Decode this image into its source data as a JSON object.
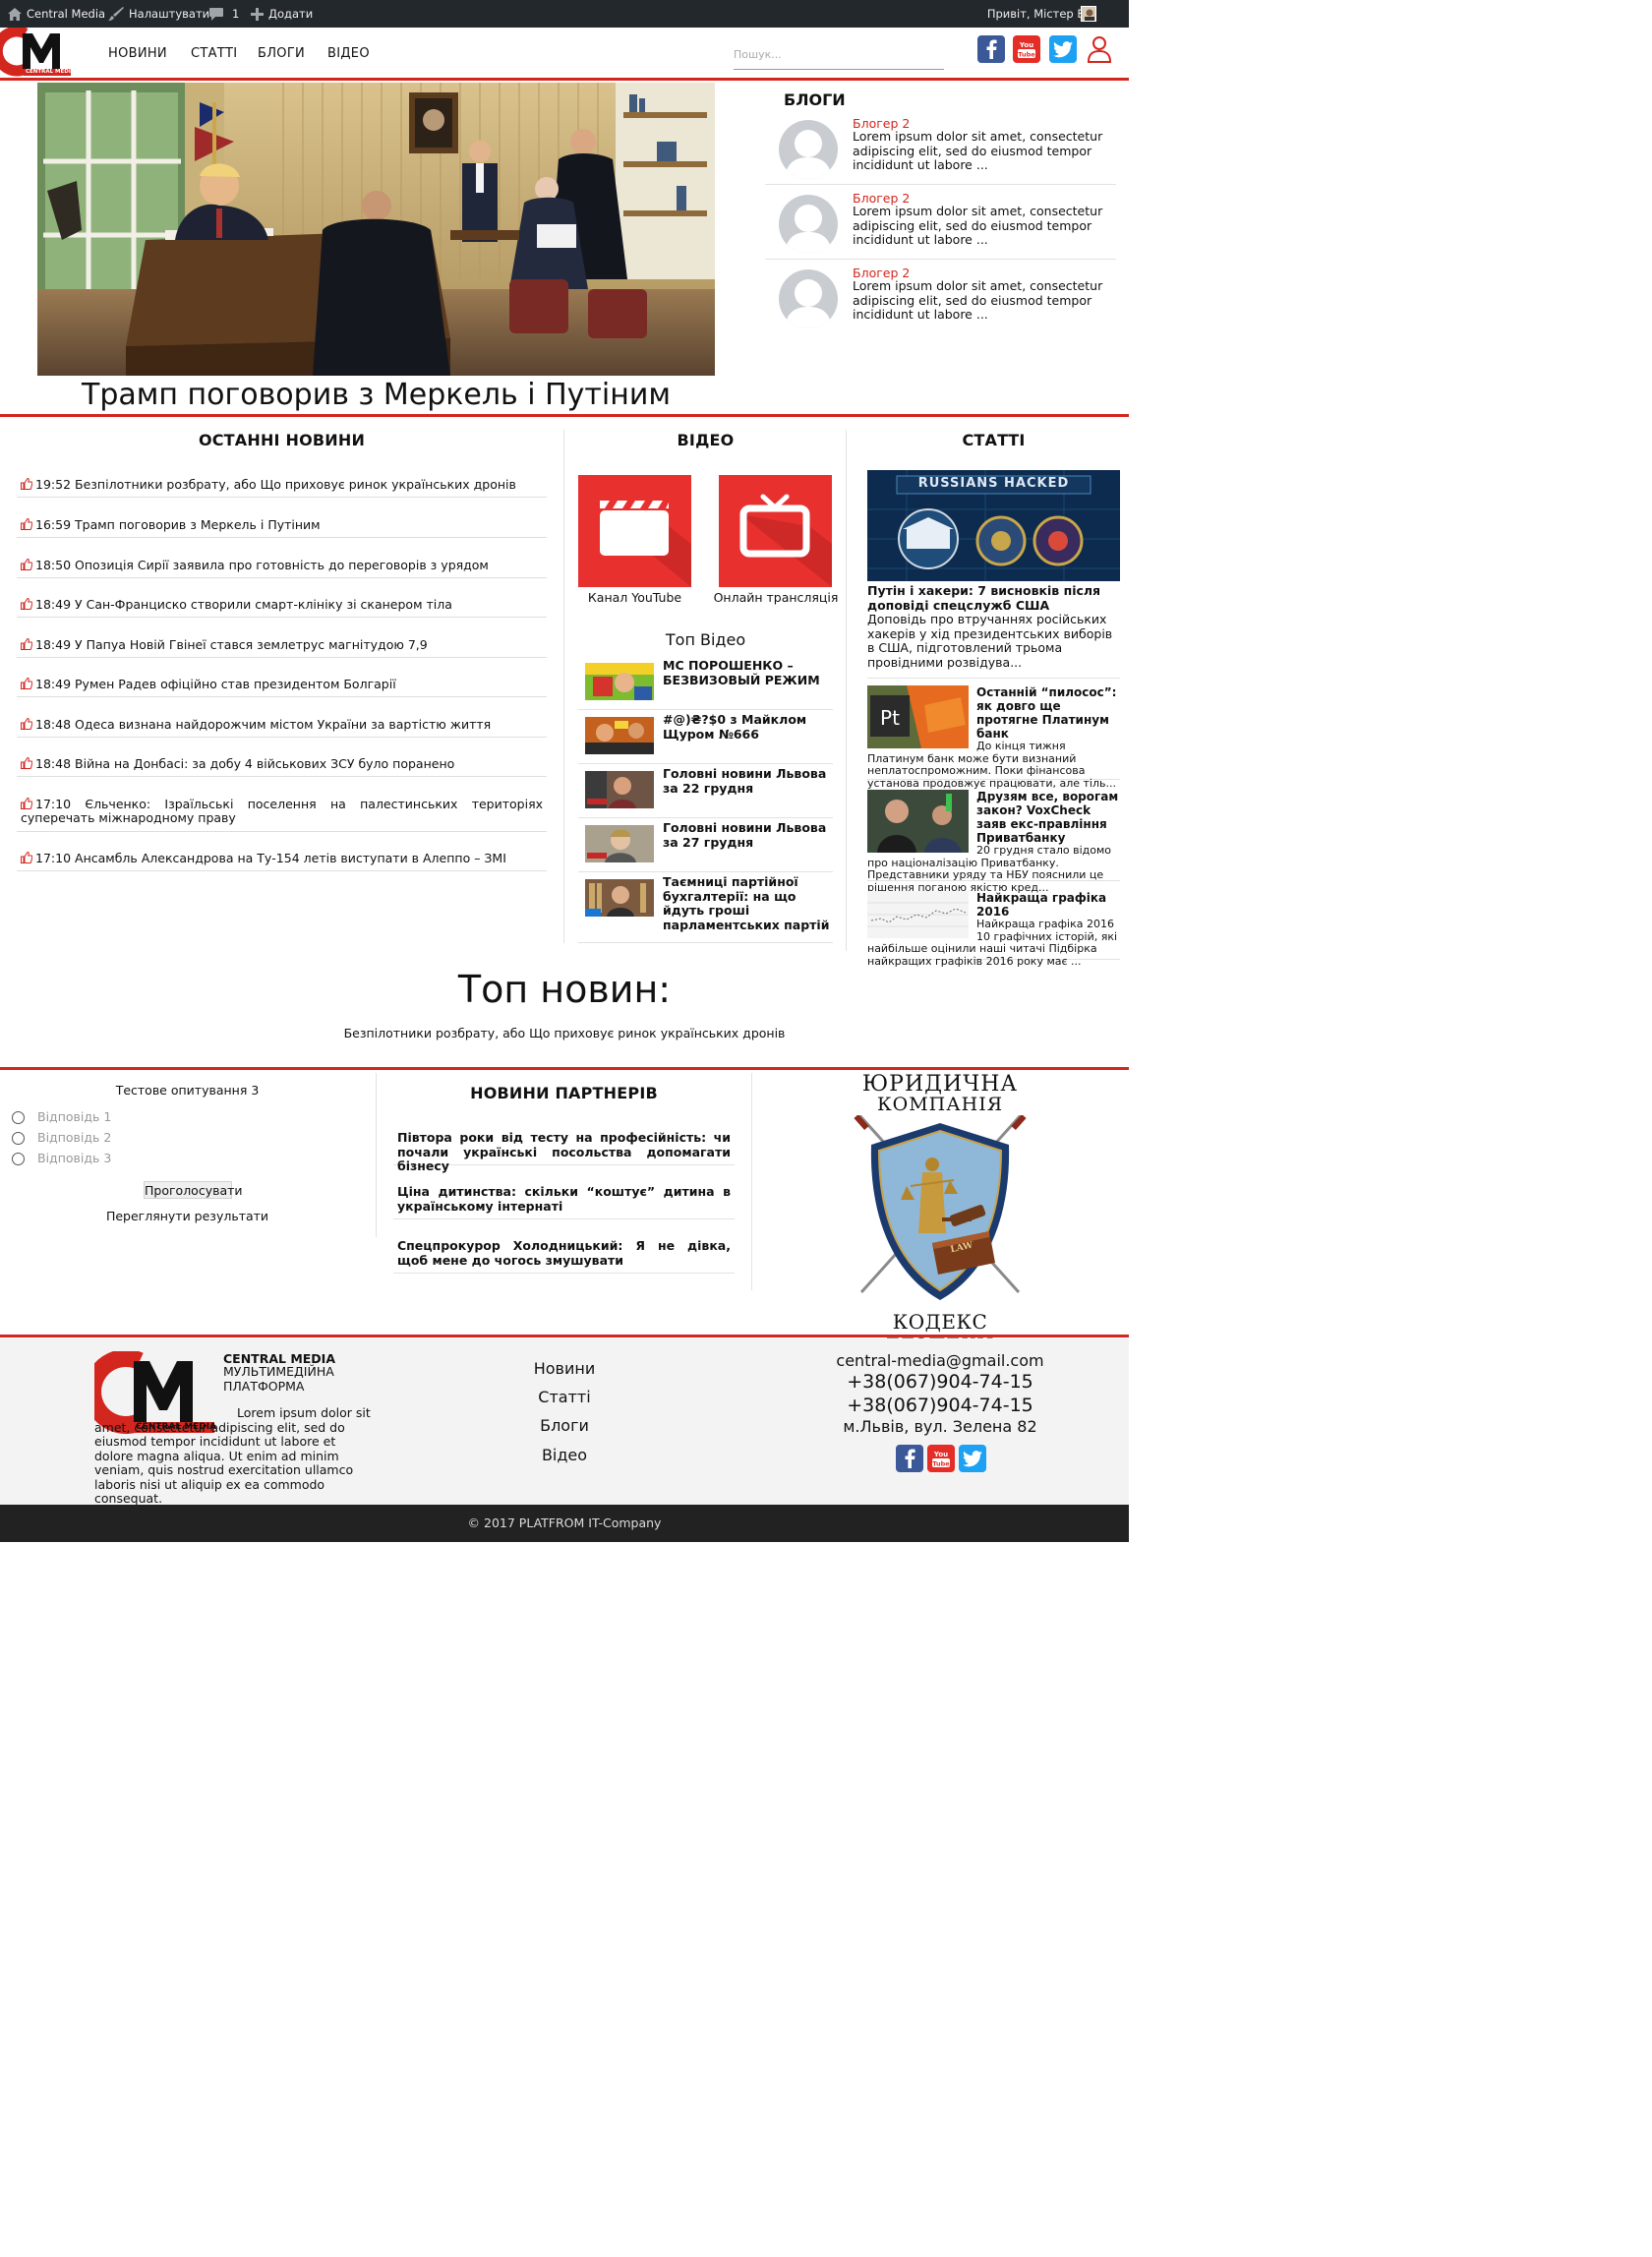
{
  "admin_bar": {
    "site_name": "Central Media",
    "customize": "Налаштувати",
    "comments_count": "1",
    "add_new": "Додати",
    "greeting": "Привіт, Містер Бін"
  },
  "header": {
    "logo_letters": "CM",
    "logo_caption": "CENTRAL MEDIA",
    "nav": [
      "НОВИНИ",
      "СТАТТІ",
      "БЛОГИ",
      "ВІДЕО"
    ],
    "search_placeholder": "Пошук..."
  },
  "hero": {
    "title": "Трамп поговорив з Меркель і Путіним"
  },
  "blogs": {
    "title": "БЛОГИ",
    "items": [
      {
        "author": "Блогер 2",
        "text": "Lorem ipsum dolor sit amet, consectetur adipiscing elit, sed do eiusmod tempor incididunt ut labore ..."
      },
      {
        "author": "Блогер 2",
        "text": "Lorem ipsum dolor sit amet, consectetur adipiscing elit, sed do eiusmod tempor incididunt ut labore ..."
      },
      {
        "author": "Блогер 2",
        "text": "Lorem ipsum dolor sit amet, consectetur adipiscing elit, sed do eiusmod tempor incididunt ut labore ..."
      }
    ]
  },
  "latest_news": {
    "title": "ОСТАННІ НОВИНИ",
    "items": [
      {
        "time": "19:52",
        "title": "Безпілотники розбрату, або Що приховує ринок українських дронів"
      },
      {
        "time": "16:59",
        "title": "Трамп поговорив з Меркель і Путіним"
      },
      {
        "time": "18:50",
        "title": "Опозиція Сирії заявила про готовність до переговорів з урядом"
      },
      {
        "time": "18:49",
        "title": "У Сан-Франциско створили смарт-клініку зі сканером тіла"
      },
      {
        "time": "18:49",
        "title": "У Папуа Новій Гвінеї стався землетрус магнітудою 7,9"
      },
      {
        "time": "18:49",
        "title": "Румен Радев офіційно став президентом Болгарії"
      },
      {
        "time": "18:48",
        "title": "Одеса визнана найдорожчим містом України за вартістю життя"
      },
      {
        "time": "18:48",
        "title": "Війна на Донбасі: за добу 4 військових ЗСУ було поранено"
      },
      {
        "time": "17:10",
        "title": "Єльченко: Ізраїльські поселення на палестинських територіях суперечать міжнародному праву"
      },
      {
        "time": "17:10",
        "title": "Ансамбль Александрова на Ту-154 летів виступати в Алеппо – ЗМІ"
      }
    ]
  },
  "video": {
    "title": "ВІДЕО",
    "youtube_label": "Канал YouTube",
    "live_label": "Онлайн трансляція",
    "top_title": "Топ Відео",
    "top_items": [
      "МС ПОРОШЕНКО – БЕЗВИЗОВЫЙ РЕЖИМ",
      "#@)₴?$0 з Майклом Щуром №666",
      "Головні новини Львова за 22 грудня",
      "Головні новини Львова за 27 грудня",
      "Таємниці партійної бухгалтерії: на що йдуть гроші парламентських партій"
    ]
  },
  "articles": {
    "title": "СТАТТІ",
    "featured": {
      "image_banner": "RUSSIANS HACKED",
      "title": "Путін і хакери: 7 висновків після доповіді спецслужб США",
      "excerpt": "Доповідь про втручаннях російських хакерів у хід президентських виборів в США, підготовлений трьома провідними розвідува..."
    },
    "items": [
      {
        "title": "Останній “пилосос”: як довго ще протягне Платинум банк",
        "excerpt": "До кінця тижня Платинум банк може бути визнаний неплатоспроможним. Поки фінансова установа продовжує працювати, але тіль...",
        "thumb_text": "Pt"
      },
      {
        "title": "Друзям все, ворогам закон? VoxCheck заяв екс-правління Приватбанку",
        "excerpt": "20 грудня стало відомо про націоналізацію Приватбанку. Представники уряду та НБУ пояснили це рішення поганою якістю кред..."
      },
      {
        "title": "Найкраща графіка 2016",
        "excerpt": "Найкраща графіка 2016 10 графічних історій, які найбільше оцінили наші читачі Підбірка найкращих графіків 2016 року має ..."
      }
    ]
  },
  "top_news": {
    "title": "Топ новин:",
    "link": "Безпілотники розбрату, або Що приховує ринок українських дронів"
  },
  "poll": {
    "question": "Тестове опитування 3",
    "answers": [
      "Відповідь 1",
      "Відповідь 2",
      "Відповідь 3"
    ],
    "vote_button": "Проголосувати",
    "results_link": "Переглянути результати"
  },
  "partners": {
    "title": "НОВИНИ ПАРТНЕРІВ",
    "items": [
      "Півтора роки від тесту на професійність: чи почали українські посольства допомагати бізнесу",
      "Ціна дитинства: скільки “коштує” дитина в українському інтернаті",
      "Спецпрокурор Холодницький: Я не дівка, щоб мене до чогось змушувати"
    ]
  },
  "ad": {
    "line1": "ЮРИДИЧНА",
    "line2": "КОМПАНІЯ",
    "shield_text": "LAW",
    "bottom": "КОДЕКС БЕЗПЕКИ"
  },
  "footer": {
    "brand": "CENTRAL MEDIA",
    "tagline": "МУЛЬТИМЕДІЙНА ПЛАТФОРМА",
    "description": "Lorem ipsum dolor sit amet, consectetur adipiscing elit, sed do eiusmod tempor incididunt ut labore et dolore magna aliqua. Ut enim ad minim veniam, quis nostrud exercitation ullamco laboris nisi ut aliquip ex ea commodo consequat.",
    "nav": [
      "Новини",
      "Статті",
      "Блоги",
      "Відео"
    ],
    "email": "central-media@gmail.com",
    "phones": [
      "+38(067)904-74-15",
      "+38(067)904-74-15"
    ],
    "address": "м.Львів, вул. Зелена 82",
    "copyright": "© 2017 PLATFROM IT-Company"
  },
  "colors": {
    "accent": "#d3261e",
    "facebook": "#3b5998",
    "youtube": "#e52d27",
    "twitter": "#1da1f2"
  }
}
